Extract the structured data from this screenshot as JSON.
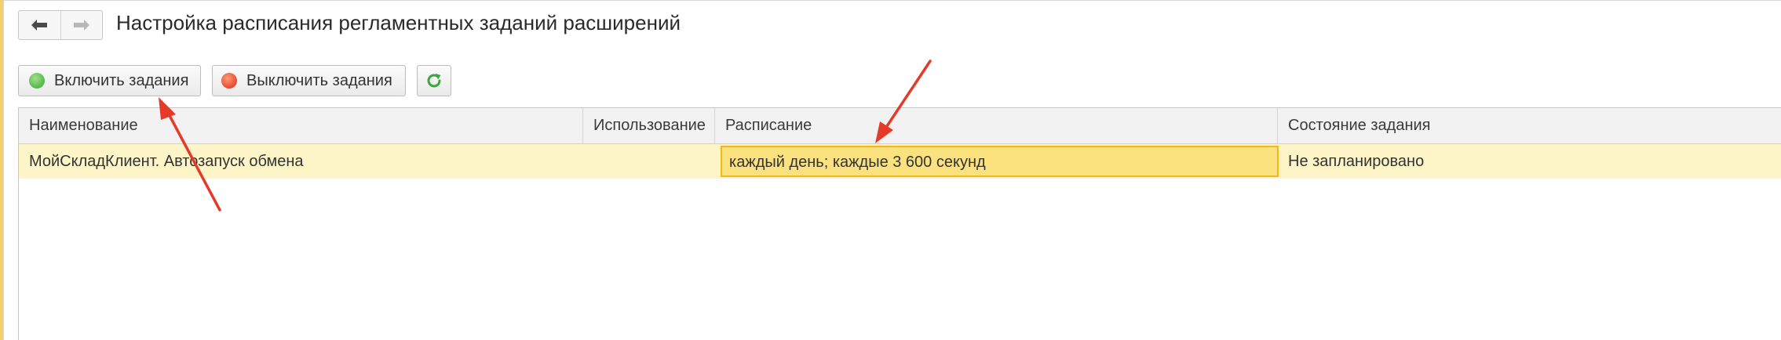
{
  "window": {
    "title": "Настройка расписания регламентных заданий расширений"
  },
  "nav": {
    "back_icon": "arrow-left-icon",
    "forward_icon": "arrow-right-icon"
  },
  "toolbar": {
    "enable_label": "Включить задания",
    "disable_label": "Выключить задания",
    "refresh_icon": "refresh-icon"
  },
  "table": {
    "columns": [
      "Наименование",
      "Использование",
      "Расписание",
      "Состояние задания"
    ],
    "rows": [
      {
        "name": "МойСкладКлиент. Автозапуск обмена",
        "usage": "",
        "schedule": "каждый день; каждые 3 600 секунд",
        "state": "Не запланировано"
      }
    ]
  },
  "colors": {
    "accent_yellow": "#f2d06b",
    "row_highlight": "#fdf4c7",
    "selected_cell": "#fbe27e",
    "selected_border": "#f1b81c",
    "annotation_arrow": "#e53a2a",
    "enable_dot": "#56b947",
    "disable_dot": "#e8492b",
    "refresh_icon": "#3aa83a"
  }
}
